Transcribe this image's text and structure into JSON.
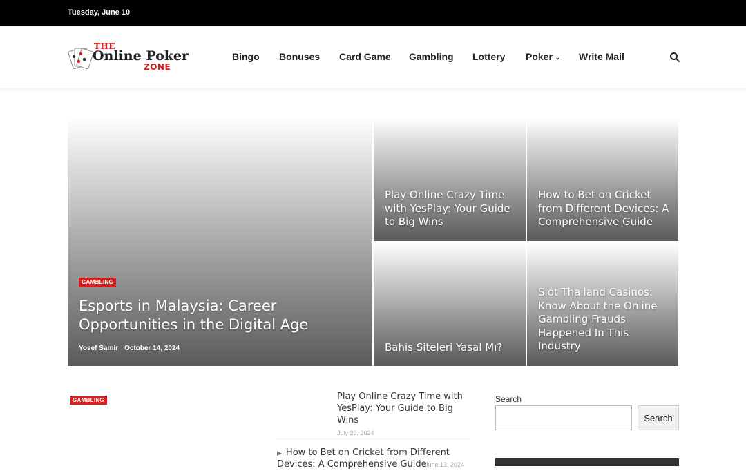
{
  "topbar": {
    "date": "Tuesday, June 10"
  },
  "logo": {
    "the": "THE",
    "main": "Online Poker",
    "zone": "ZONE"
  },
  "nav": {
    "items": [
      {
        "label": "Bingo"
      },
      {
        "label": "Bonuses"
      },
      {
        "label": "Card Game"
      },
      {
        "label": "Gambling"
      },
      {
        "label": "Lottery"
      },
      {
        "label": "Poker"
      },
      {
        "label": "Write Mail"
      }
    ]
  },
  "featured": {
    "main": {
      "category": "GAMBLING",
      "title": "Esports in Malaysia: Career Opportunities in the Digital Age",
      "author": "Yosef Samir",
      "date": "October 14, 2024"
    },
    "tiles": [
      {
        "title": "Play Online Crazy Time with YesPlay: Your Guide to Big Wins"
      },
      {
        "title": "How to Bet on Cricket from Different Devices: A Comprehensive Guide"
      },
      {
        "title": "Bahis Siteleri Yasal Mı?"
      },
      {
        "title": "Slot Thailand Casinos: Know About the Online Gambling Frauds Happened In This Industry"
      }
    ]
  },
  "lower": {
    "category": "GAMBLING",
    "list": [
      {
        "title": "Play Online Crazy Time with YesPlay: Your Guide to Big Wins",
        "date": "July 29, 2024"
      },
      {
        "title": "How to Bet on Cricket from Different Devices: A Comprehensive Guide",
        "date": "June 13, 2024"
      }
    ]
  },
  "sidebar": {
    "search_label": "Search",
    "search_button": "Search",
    "search_value": ""
  },
  "colors": {
    "accent": "#d21f1f",
    "topbar": "#000000"
  }
}
